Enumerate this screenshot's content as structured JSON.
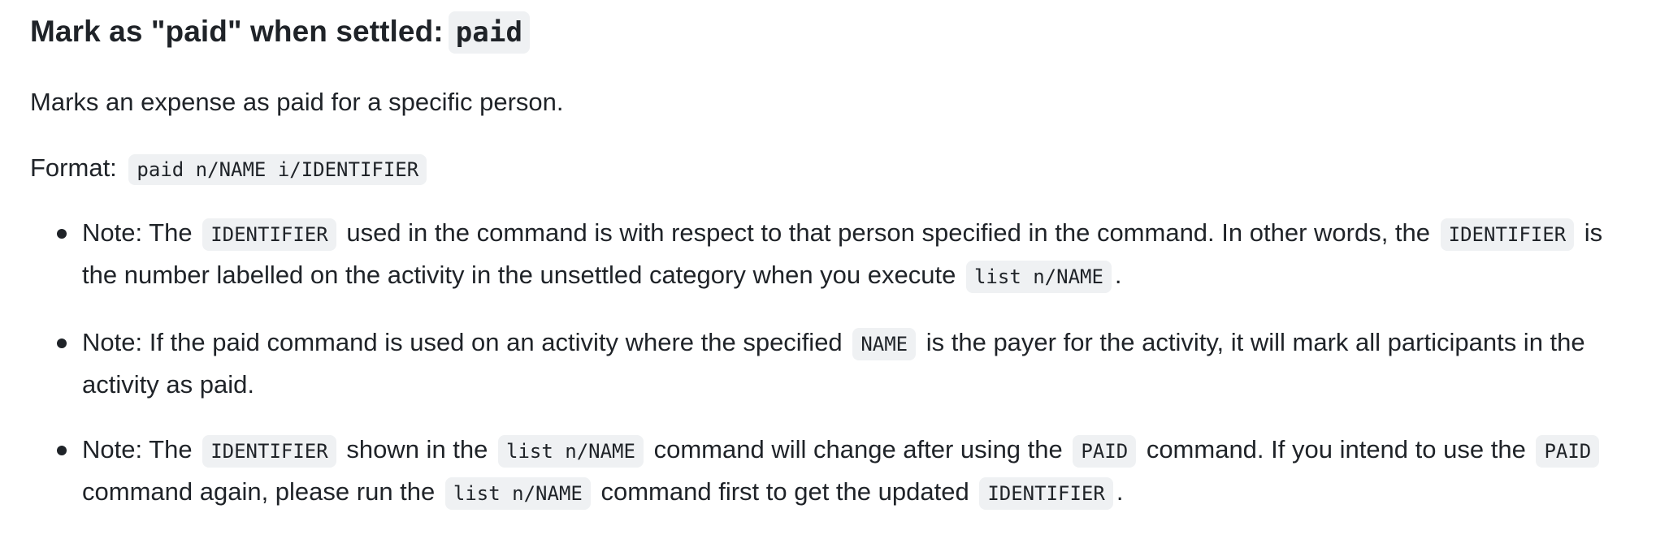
{
  "heading": {
    "text": "Mark as \"paid\" when settled:",
    "code": "paid"
  },
  "description": "Marks an expense as paid for a specific person.",
  "format": {
    "label": "Format:",
    "code": "paid n/NAME i/IDENTIFIER"
  },
  "notes": [
    {
      "line1_a": "Note: The",
      "line1_code1": "IDENTIFIER",
      "line1_b": "used in the command is with respect to that person specified in the command. In other words, the",
      "line1_code2": "IDENTIFIER",
      "line1_c": "is",
      "line2_a": "the number labelled on the activity in the unsettled category when you execute",
      "line2_code": "list n/NAME",
      "line2_b": "."
    },
    {
      "line1_a": "Note: If the paid command is used on an activity where the specified",
      "line1_code": "NAME",
      "line1_b": "is the payer for the activity, it will mark all participants in the",
      "line2": "activity as paid."
    },
    {
      "line1_a": "Note: The",
      "line1_code1": "IDENTIFIER",
      "line1_b": "shown in the",
      "line1_code2": "list n/NAME",
      "line1_c": "command will change after using the",
      "line1_code3": "PAID",
      "line1_d": "command. If you intend to use the",
      "line1_code4": "PAID",
      "line2_a": "command again, please run the",
      "line2_code1": "list n/NAME",
      "line2_b": "command first to get the updated",
      "line2_code2": "IDENTIFIER",
      "line2_c": "."
    }
  ]
}
